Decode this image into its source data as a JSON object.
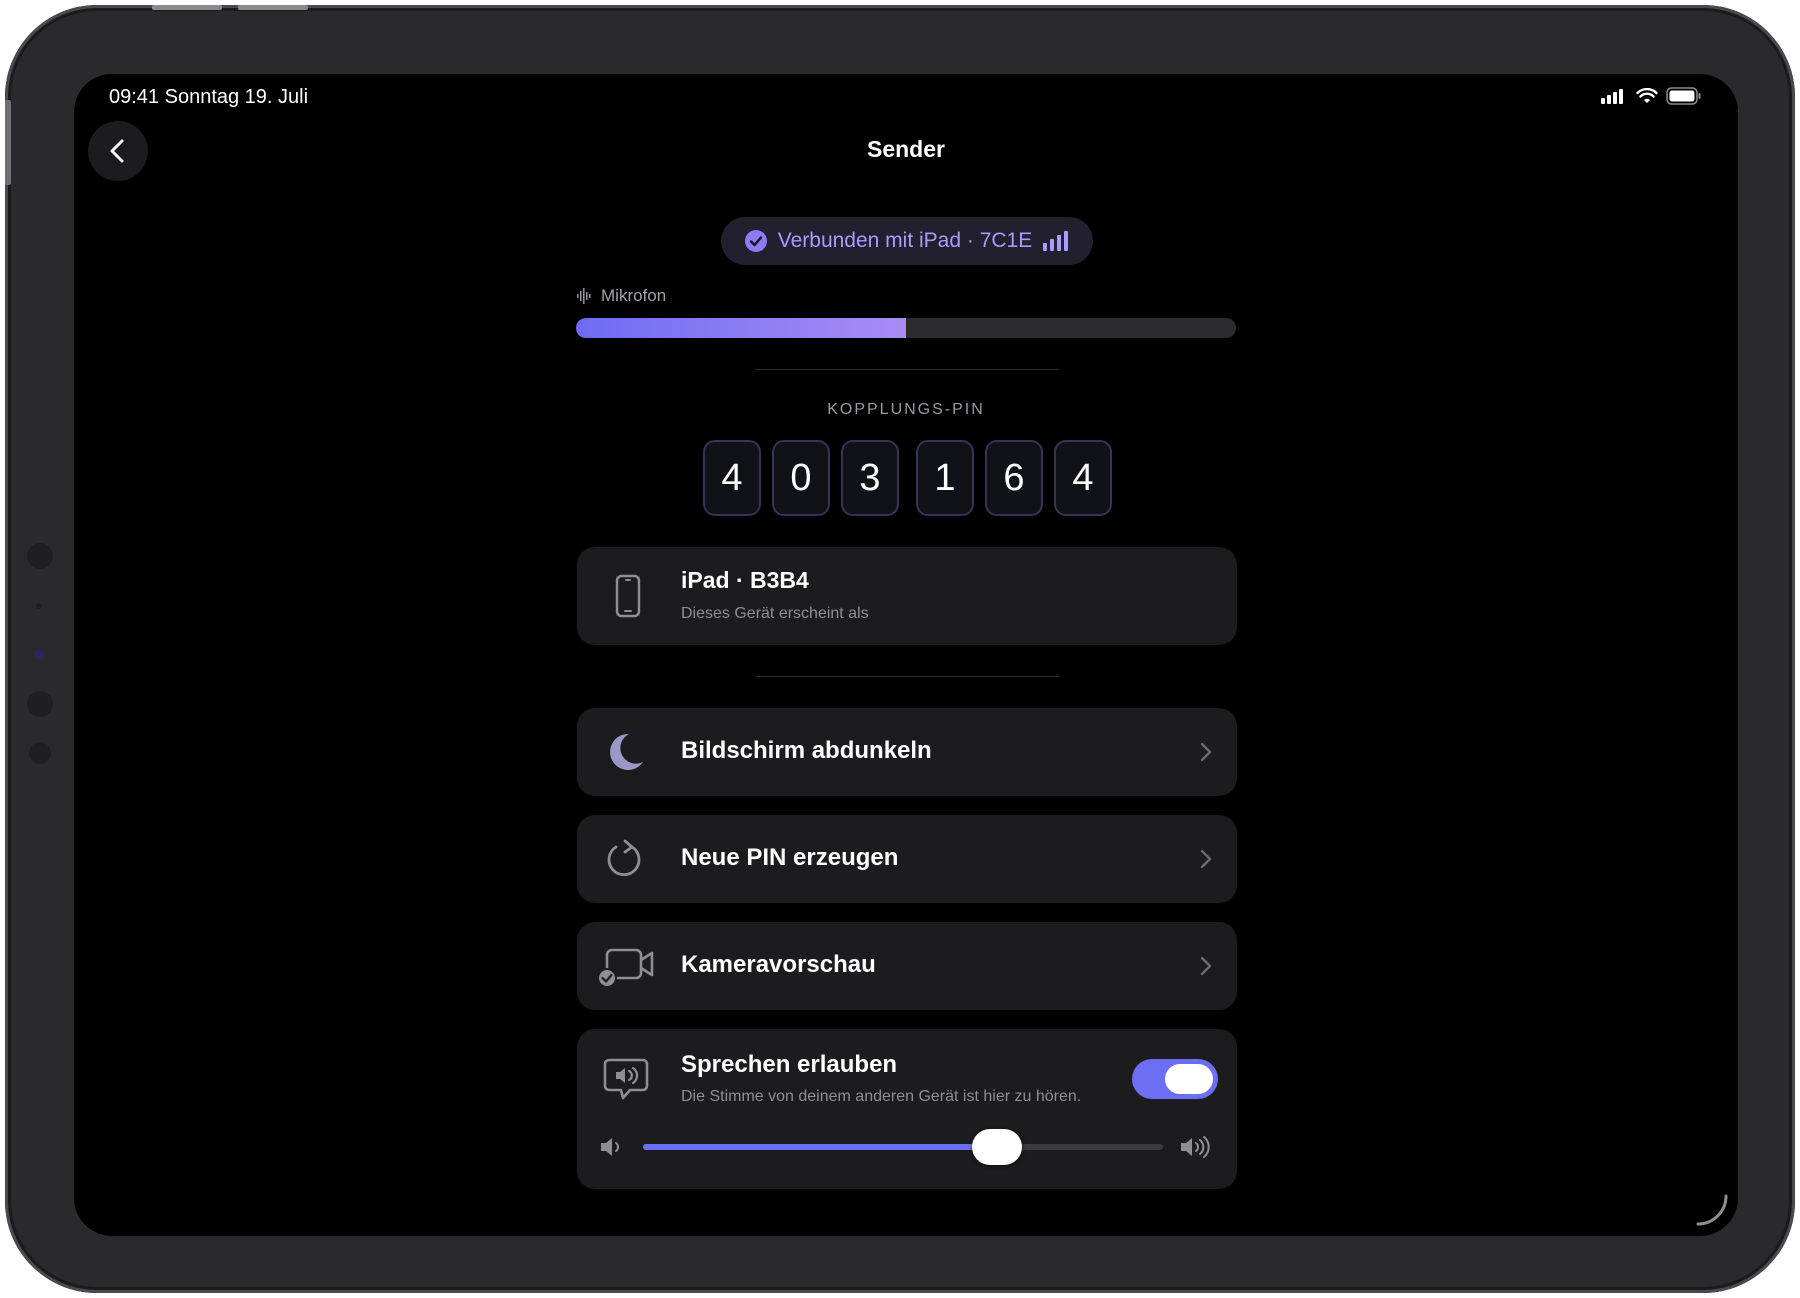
{
  "status_bar": {
    "time_date": "09:41   Sonntag 19. Juli"
  },
  "nav": {
    "title": "Sender"
  },
  "connection": {
    "label": "Verbunden mit iPad · 7C1E"
  },
  "microphone": {
    "label": "Mikrofon",
    "level": 0.5
  },
  "pairing": {
    "title": "KOPPLUNGS-PIN",
    "digits": [
      "4",
      "0",
      "3",
      "1",
      "6",
      "4"
    ]
  },
  "device": {
    "name": "iPad · B3B4",
    "caption": "Dieses Gerät erscheint als"
  },
  "menu": {
    "dim_screen": "Bildschirm abdunkeln",
    "new_pin": "Neue PIN erzeugen",
    "camera_preview": "Kameravorschau"
  },
  "speech": {
    "title": "Sprechen erlauben",
    "description": "Die Stimme von deinem anderen Gerät ist hier zu hören.",
    "enabled": true,
    "volume": 0.68
  },
  "colors": {
    "accent": "#6d6ff2",
    "accent_light": "#a89cff",
    "card": "#1c1c1e",
    "background": "#000000"
  },
  "icons": [
    "chevron-left-icon",
    "cellular-signal-icon",
    "wifi-icon",
    "battery-icon",
    "checkmark-circle-icon",
    "signal-bars-icon",
    "waveform-icon",
    "iphone-icon",
    "moon-icon",
    "refresh-icon",
    "video-camera-icon",
    "speech-bubble-speaker-icon",
    "chevron-right-icon",
    "speaker-low-icon",
    "speaker-high-icon"
  ]
}
